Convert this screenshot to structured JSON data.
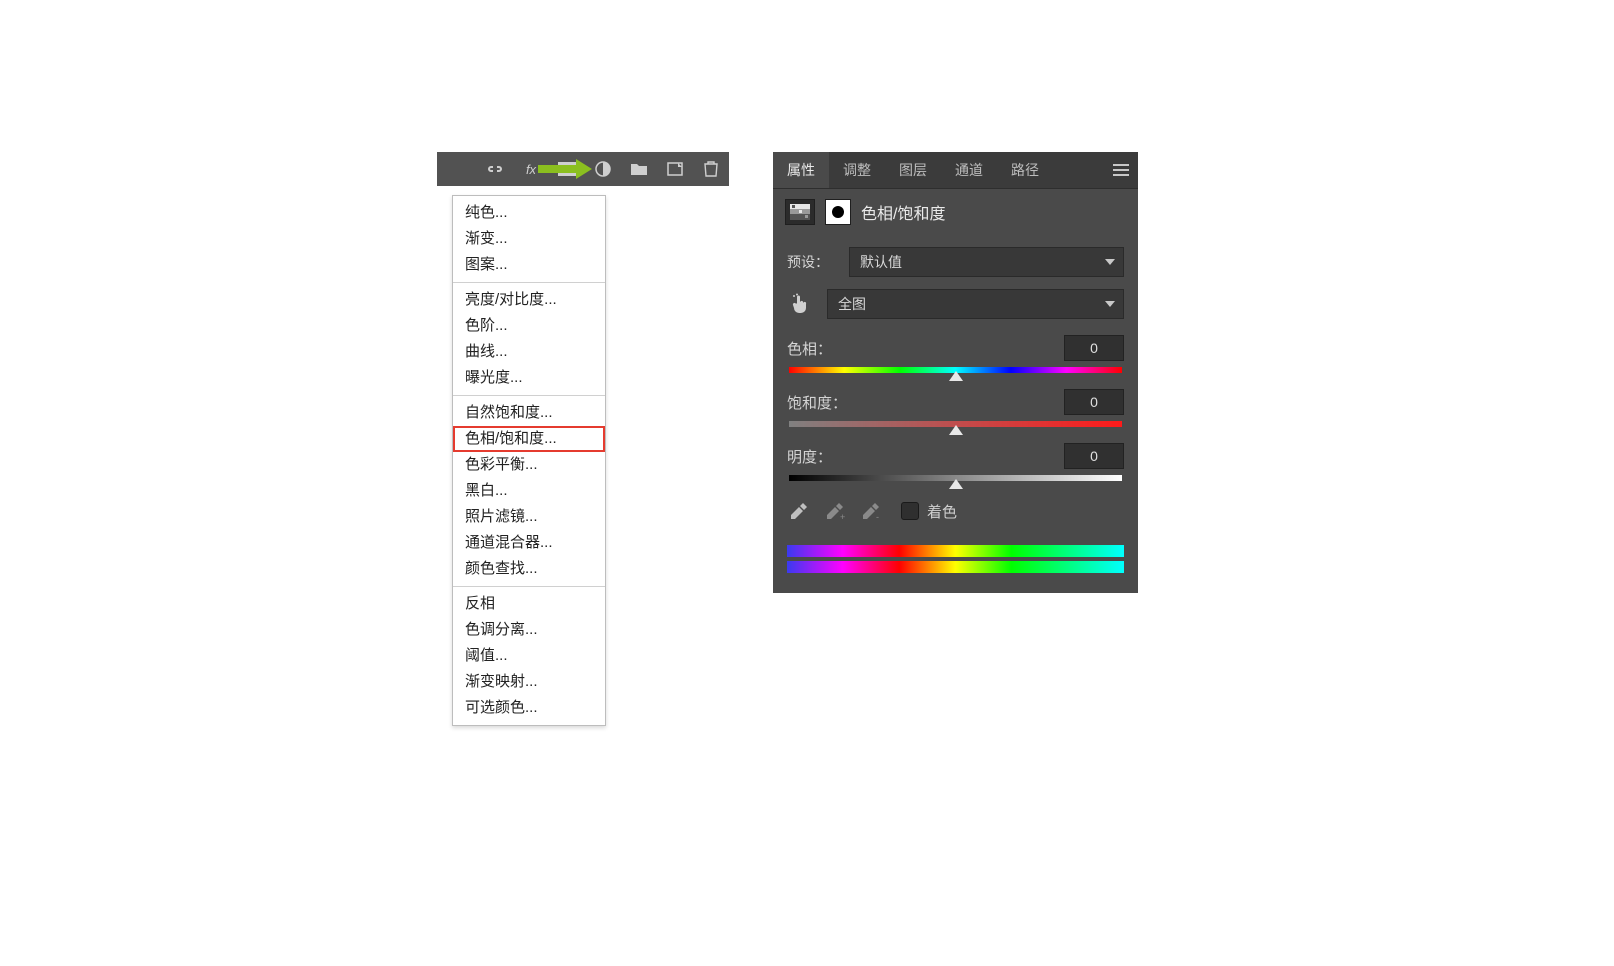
{
  "toolbar": {
    "icons": [
      "link-icon",
      "fx-icon",
      "mask-icon",
      "adjustment-icon",
      "folder-icon",
      "new-layer-icon",
      "trash-icon"
    ]
  },
  "dropdown": {
    "groups": [
      [
        "纯色...",
        "渐变...",
        "图案..."
      ],
      [
        "亮度/对比度...",
        "色阶...",
        "曲线...",
        "曝光度..."
      ],
      [
        "自然饱和度...",
        "色相/饱和度...",
        "色彩平衡...",
        "黑白...",
        "照片滤镜...",
        "通道混合器...",
        "颜色查找..."
      ],
      [
        "反相",
        "色调分离...",
        "阈值...",
        "渐变映射...",
        "可选颜色..."
      ]
    ],
    "highlight": "色相/饱和度..."
  },
  "panel": {
    "tabs": [
      "属性",
      "调整",
      "图层",
      "通道",
      "路径"
    ],
    "active_tab": "属性",
    "title": "色相/饱和度",
    "preset_label": "预设：",
    "preset_value": "默认值",
    "range_value": "全图",
    "sliders": {
      "hue": {
        "label": "色相：",
        "value": "0"
      },
      "sat": {
        "label": "饱和度：",
        "value": "0"
      },
      "light": {
        "label": "明度：",
        "value": "0"
      }
    },
    "colorize_label": "着色"
  }
}
